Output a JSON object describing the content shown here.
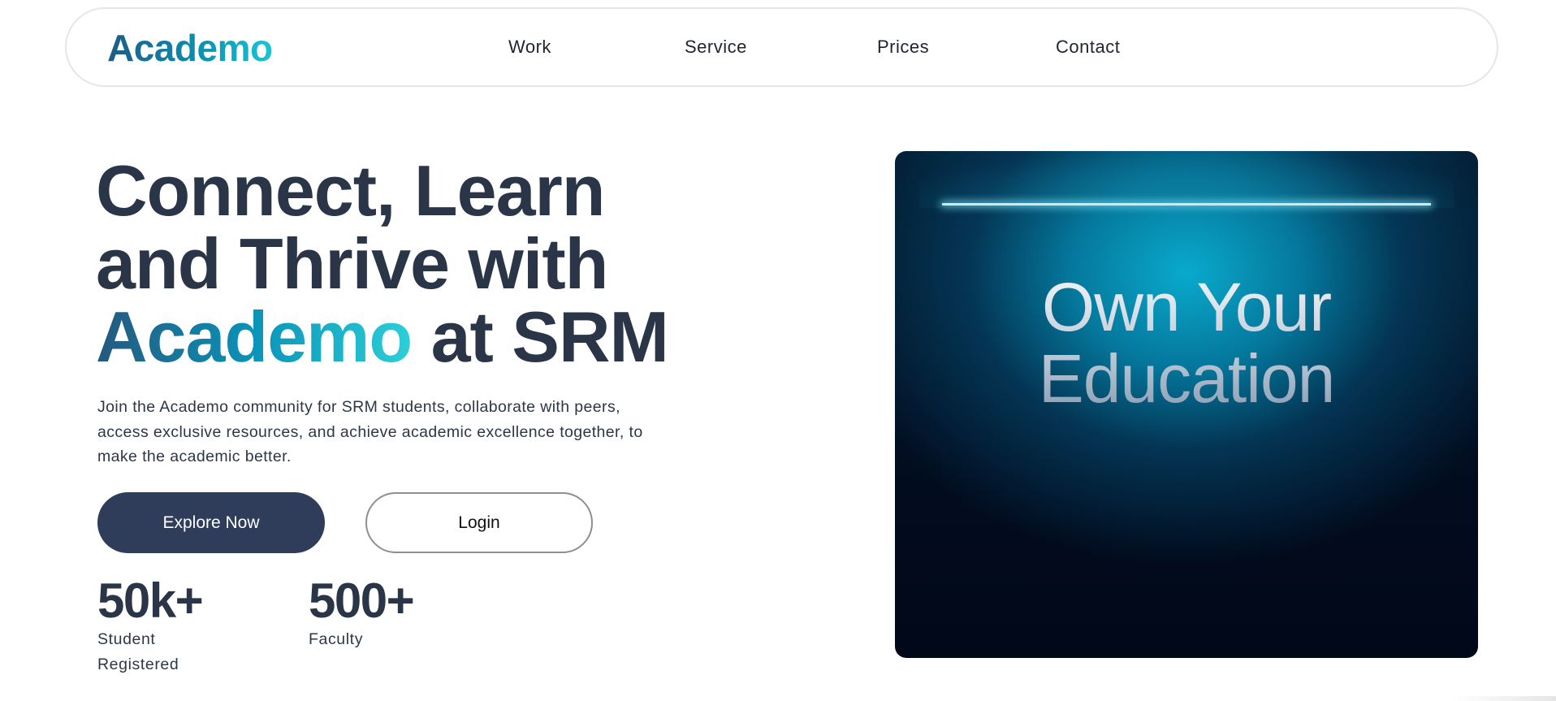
{
  "brand": {
    "name": "Academo"
  },
  "nav": {
    "items": [
      {
        "label": "Work"
      },
      {
        "label": "Service"
      },
      {
        "label": "Prices"
      },
      {
        "label": "Contact"
      }
    ]
  },
  "hero": {
    "title_line1": "Connect, Learn",
    "title_line2": "and Thrive with",
    "title_brand": "Academo",
    "title_suffix": " at SRM",
    "description": "Join the Academo community for SRM students, collaborate with peers, access exclusive resources, and achieve academic excellence together, to make the academic better.",
    "primary_button": "Explore Now",
    "secondary_button": "Login"
  },
  "stats": [
    {
      "value": "50k+",
      "label": "Student Registered"
    },
    {
      "value": "500+",
      "label": "Faculty"
    }
  ],
  "feature": {
    "heading_line1": "Own Your",
    "heading_line2": "Education"
  },
  "colors": {
    "heading": "#2b3548",
    "primary_button": "#2f3d5a",
    "accent_start": "#25587e",
    "accent_end": "#2ccfd8",
    "card_bg": "#020d20",
    "card_glow": "#09aacd"
  }
}
